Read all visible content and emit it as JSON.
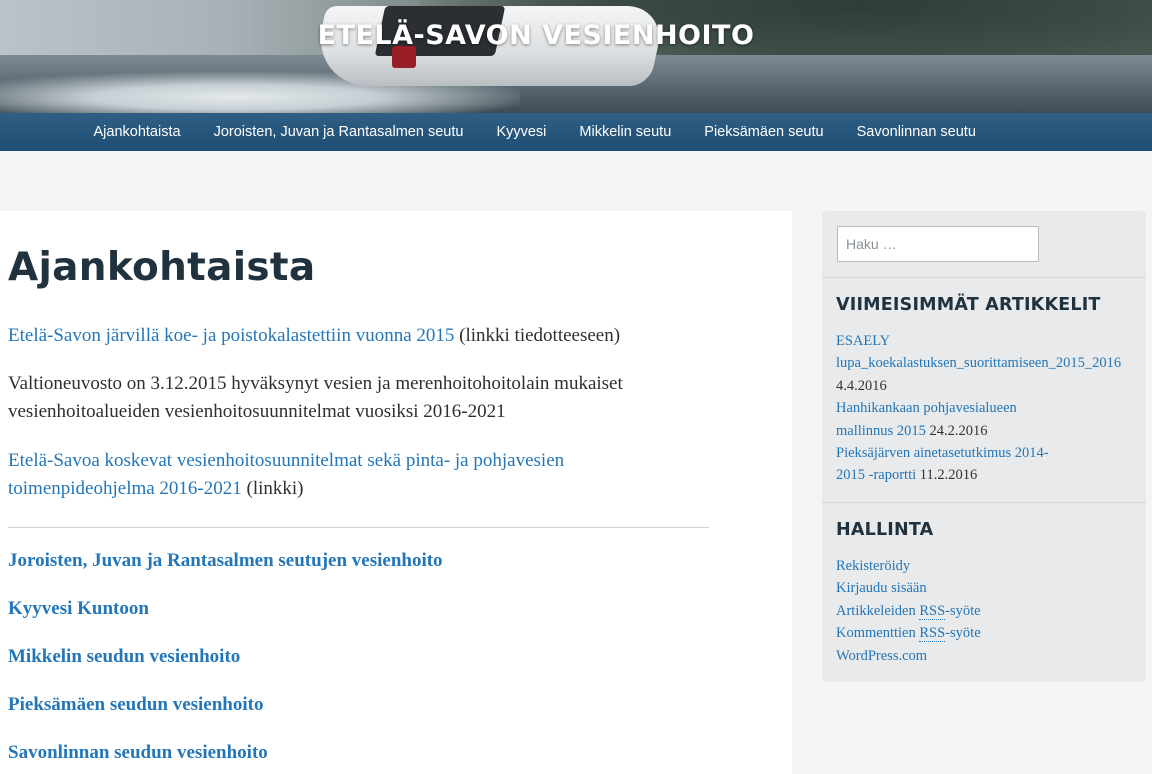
{
  "site": {
    "title": "ETELÄ-SAVON VESIENHOITO"
  },
  "nav": {
    "items": [
      "Ajankohtaista",
      "Joroisten, Juvan ja Rantasalmen seutu",
      "Kyyvesi",
      "Mikkelin seutu",
      "Pieksämäen seutu",
      "Savonlinnan seutu"
    ]
  },
  "main": {
    "title": "Ajankohtaista",
    "p1_link": "Etelä-Savon järvillä koe- ja poistokalastettiin vuonna 2015",
    "p1_rest": " (linkki tiedotteeseen)",
    "p2": "Valtioneuvosto on 3.12.2015 hyväksynyt vesien ja merenhoitohoitolain mukaiset vesienhoitoalueiden vesienhoitosuunnitelmat vuosiksi 2016-2021",
    "p3_link": "Etelä-Savoa koskevat vesienhoitosuunnitelmat sekä pinta- ja pohjavesien toimenpideohjelma 2016-2021",
    "p3_rest": " (linkki)",
    "sections": [
      "Joroisten, Juvan ja Rantasalmen seutujen vesienhoito",
      "Kyyvesi Kuntoon",
      "Mikkelin seudun vesienhoito",
      "Pieksämäen seudun vesienhoito",
      "Savonlinnan seudun vesienhoito"
    ]
  },
  "sidebar": {
    "search_placeholder": "Haku …",
    "recent_title": "VIIMEISIMMÄT ARTIKKELIT",
    "recent": [
      {
        "line1": "ESAELY",
        "line2": "lupa_koekalastuksen_suorittamiseen_2015_2016",
        "date": "4.4.2016"
      },
      {
        "line1": "Hanhikankaan pohjavesialueen",
        "line2": "mallinnus 2015",
        "date": "24.2.2016"
      },
      {
        "line1": "Pieksäjärven ainetasetutkimus 2014-",
        "line2": "2015 -raportti",
        "date": "11.2.2016"
      }
    ],
    "admin_title": "HALLINTA",
    "admin": {
      "register": "Rekisteröidy",
      "login": "Kirjaudu sisään",
      "entries_pre": "Artikkeleiden ",
      "entries_rss": "RSS",
      "entries_post": "-syöte",
      "comments_pre": "Kommenttien ",
      "comments_rss": "RSS",
      "comments_post": "-syöte",
      "wordpress": "WordPress.com"
    }
  }
}
